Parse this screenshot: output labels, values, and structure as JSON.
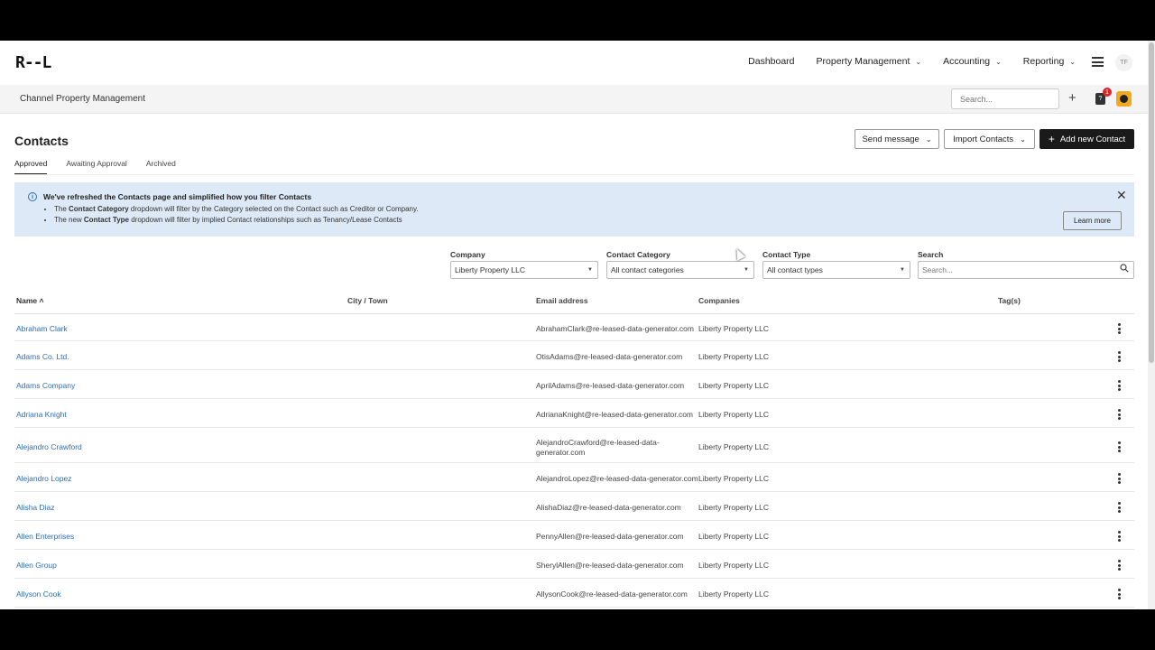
{
  "app": {
    "logo": "R-‑L"
  },
  "nav": {
    "items": [
      {
        "label": "Dashboard",
        "dropdown": false
      },
      {
        "label": "Property Management",
        "dropdown": true
      },
      {
        "label": "Accounting",
        "dropdown": true
      },
      {
        "label": "Reporting",
        "dropdown": true
      }
    ],
    "user_initials": "TF"
  },
  "subbar": {
    "title": "Channel Property Management",
    "search_placeholder": "Search...",
    "notification_count": "1"
  },
  "page": {
    "title": "Contacts",
    "tabs": [
      {
        "label": "Approved",
        "active": true
      },
      {
        "label": "Awaiting Approval",
        "active": false
      },
      {
        "label": "Archived",
        "active": false
      }
    ],
    "buttons": {
      "send_message": "Send message",
      "import_contacts": "Import Contacts",
      "add_new_contact": "Add new Contact"
    }
  },
  "banner": {
    "title": "We've refreshed the Contacts page and simplified how you filter Contacts",
    "line1_pre": "The ",
    "line1_bold": "Contact Category",
    "line1_post": " dropdown will filter by the Category selected on the Contact such as Creditor or Company.",
    "line2_pre": "The new ",
    "line2_bold": "Contact Type",
    "line2_post": " dropdown will filter by implied Contact relationships such as Tenancy/Lease Contacts",
    "learn_more": "Learn more"
  },
  "filters": {
    "company": {
      "label": "Company",
      "value": "Liberty Property LLC"
    },
    "category": {
      "label": "Contact Category",
      "value": "All contact categories"
    },
    "type": {
      "label": "Contact Type",
      "value": "All contact types"
    },
    "search": {
      "label": "Search",
      "placeholder": "Search..."
    }
  },
  "table": {
    "headers": {
      "name": "Name",
      "city": "City / Town",
      "email": "Email address",
      "companies": "Companies",
      "tags": "Tag(s)"
    },
    "rows": [
      {
        "name": "Abraham Clark",
        "email": "AbrahamClark@re-leased-data-generator.com",
        "company": "Liberty Property LLC"
      },
      {
        "name": "Adams Co. Ltd.",
        "email": "OtisAdams@re-leased-data-generator.com",
        "company": "Liberty Property LLC"
      },
      {
        "name": "Adams Company",
        "email": "AprilAdams@re-leased-data-generator.com",
        "company": "Liberty Property LLC"
      },
      {
        "name": "Adriana Knight",
        "email": "AdrianaKnight@re-leased-data-generator.com",
        "company": "Liberty Property LLC"
      },
      {
        "name": "Alejandro Crawford",
        "email": "AlejandroCrawford@re-leased-data-generator.com",
        "company": "Liberty Property LLC"
      },
      {
        "name": "Alejandro Lopez",
        "email": "AlejandroLopez@re-leased-data-generator.com",
        "company": "Liberty Property LLC"
      },
      {
        "name": "Alisha Diaz",
        "email": "AlishaDiaz@re-leased-data-generator.com",
        "company": "Liberty Property LLC"
      },
      {
        "name": "Allen Enterprises",
        "email": "PennyAllen@re-leased-data-generator.com",
        "company": "Liberty Property LLC"
      },
      {
        "name": "Allen Group",
        "email": "SherylAllen@re-leased-data-generator.com",
        "company": "Liberty Property LLC"
      },
      {
        "name": "Allyson Cook",
        "email": "AllysonCook@re-leased-data-generator.com",
        "company": "Liberty Property LLC"
      }
    ]
  }
}
